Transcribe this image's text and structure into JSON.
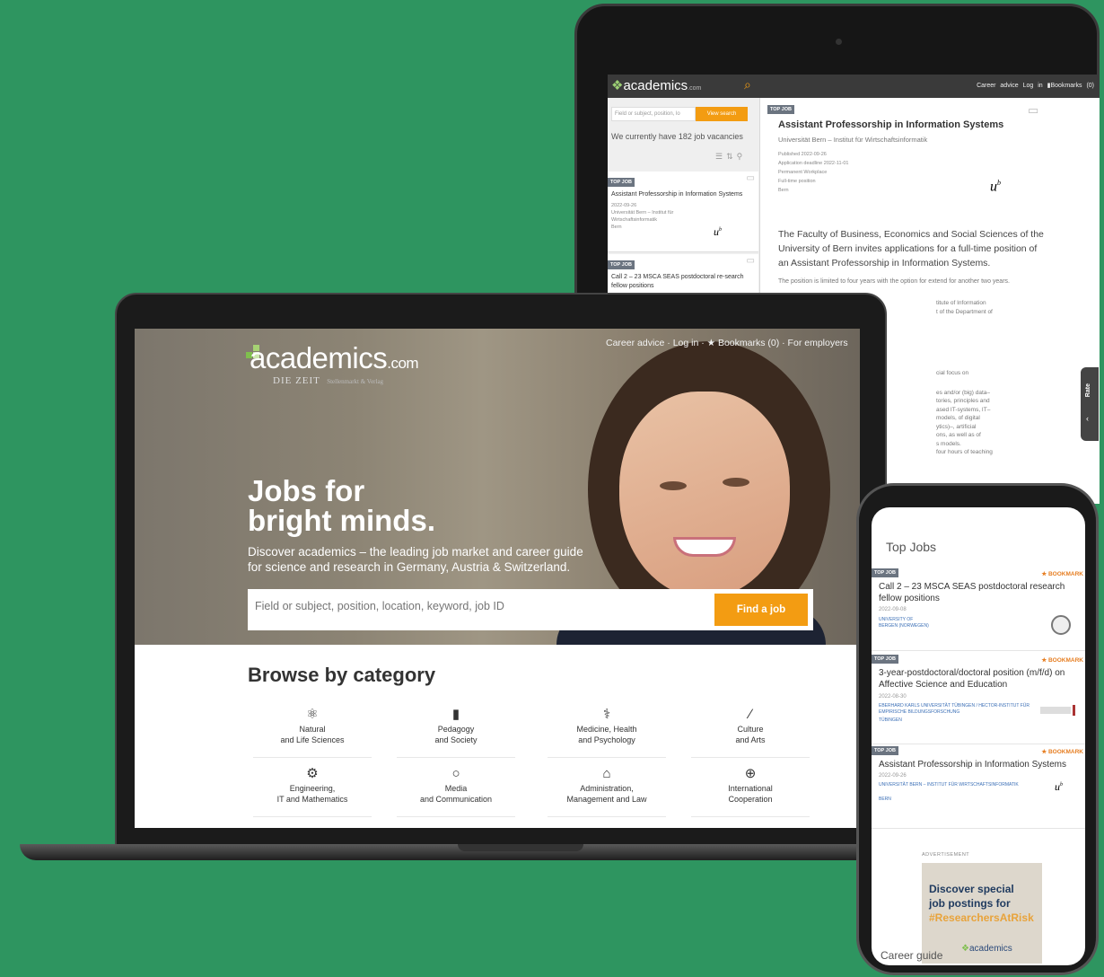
{
  "tablet": {
    "logo": "academics",
    "logo_suffix": "com",
    "nav": [
      "Career advice",
      "Log in",
      "Bookmarks (0)"
    ],
    "search_placeholder": "Field or subject, position, lo",
    "view_button": "View search",
    "vacancies_text": "We currently have 182 job vacancies",
    "list": [
      {
        "tag": "TOP JOB",
        "title": "Assistant Professorship in Information Systems",
        "date": "2022-09-26",
        "org": "Universität Bern – Institut für Wirtschaftsinformatik",
        "location": "Bern"
      },
      {
        "tag": "TOP JOB",
        "title": "Call 2 – 23 MSCA SEAS postdoctoral re-search fellow positions"
      }
    ],
    "detail": {
      "tag": "TOP JOB",
      "title": "Assistant Professorship in Information Systems",
      "institution": "Universität Bern – Institut für Wirtschaftsinformatik",
      "facts": [
        "Published 2022-09-26",
        "Application deadline 2022-11-01",
        "Permanent Workplace",
        "Full-time position",
        "Bern"
      ],
      "lead": "The Faculty of Business, Economics and Social Sciences of the University of Bern invites applications for a full-time position of an Assistant Professorship in Information Systems.",
      "para": "The position is limited to four years with the option for extend for another two years.",
      "fragments": [
        "titute of Information",
        "t of the Department of",
        "cial focus on",
        "es and/or (big) data–",
        "tories, principles and",
        "ased IT-systems, IT–",
        "models, of digital",
        "ytics)–, artificial",
        "ons, as well as of",
        "s models.",
        "four hours of teaching"
      ],
      "rate_label": "Rate"
    }
  },
  "laptop": {
    "logo": "academics",
    "logo_suffix": ".com",
    "zeit": "DIE ZEIT",
    "zeit_sub": "Stellenmarkt & Verlag",
    "nav": "Career advice · Log in · ★ Bookmarks (0) · For employers",
    "headline_1": "Jobs for",
    "headline_2": "bright minds.",
    "subheadline": "Discover academics – the leading job market and career guide for science and research in Germany, Austria & Switzerland.",
    "search_placeholder": "Field or subject, position, location, keyword, job ID",
    "find_button": "Find a job",
    "browse_heading": "Browse by category",
    "categories": [
      {
        "icon": "atom-icon",
        "glyph": "⚛",
        "line1": "Natural",
        "line2": "and Life Sciences"
      },
      {
        "icon": "book-icon",
        "glyph": "▮",
        "line1": "Pedagogy",
        "line2": "and Society"
      },
      {
        "icon": "dna-icon",
        "glyph": "⚕",
        "line1": "Medicine, Health",
        "line2": "and Psychology"
      },
      {
        "icon": "brush-icon",
        "glyph": "∕",
        "line1": "Culture",
        "line2": "and Arts"
      },
      {
        "icon": "gear-icon",
        "glyph": "⚙",
        "line1": "Engineering,",
        "line2": "IT and Mathematics"
      },
      {
        "icon": "speech-bubble-icon",
        "glyph": "○",
        "line1": "Media",
        "line2": "and Communication"
      },
      {
        "icon": "institution-icon",
        "glyph": "⌂",
        "line1": "Administration,",
        "line2": "Management and Law"
      },
      {
        "icon": "globe-icon",
        "glyph": "⊕",
        "line1": "International",
        "line2": "Cooperation"
      }
    ]
  },
  "phone": {
    "heading": "Top Jobs",
    "jobs": [
      {
        "tag": "TOP JOB",
        "bookmark": "★ BOOKMARK",
        "title": "Call 2 – 23 MSCA SEAS postdoctoral research fellow positions",
        "date": "2022-09-08",
        "org": "UNIVERSITY OF BERGEN (NORWEGEN)"
      },
      {
        "tag": "TOP JOB",
        "bookmark": "★ BOOKMARK",
        "title": "3-year-postdoctoral/doctoral position (m/f/d) on Affective Science and Education",
        "date": "2022-08-30",
        "org": "EBERHARD KARLS UNIVERSITÄT TÜBINGEN / HECTOR-INSTITUT FÜR EMPIRISCHE BILDUNGSFORSCHUNG",
        "location": "TÜBINGEN"
      },
      {
        "tag": "TOP JOB",
        "bookmark": "★ BOOKMARK",
        "title": "Assistant Professorship in Information Systems",
        "date": "2022-09-26",
        "org": "UNIVERSITÄT BERN – INSTITUT FÜR WIRTSCHAFTSINFORMATIK",
        "location": "BERN"
      }
    ],
    "ad_label": "ADVERTISEMENT",
    "ad_line1": "Discover special",
    "ad_line2": "job postings for",
    "ad_line3": "#ResearchersAtRisk",
    "ad_logo": "academics",
    "career_guide": "Career guide"
  },
  "colors": {
    "background": "#2e9560",
    "accent": "#f39c12",
    "toptag": "#6b7480"
  }
}
